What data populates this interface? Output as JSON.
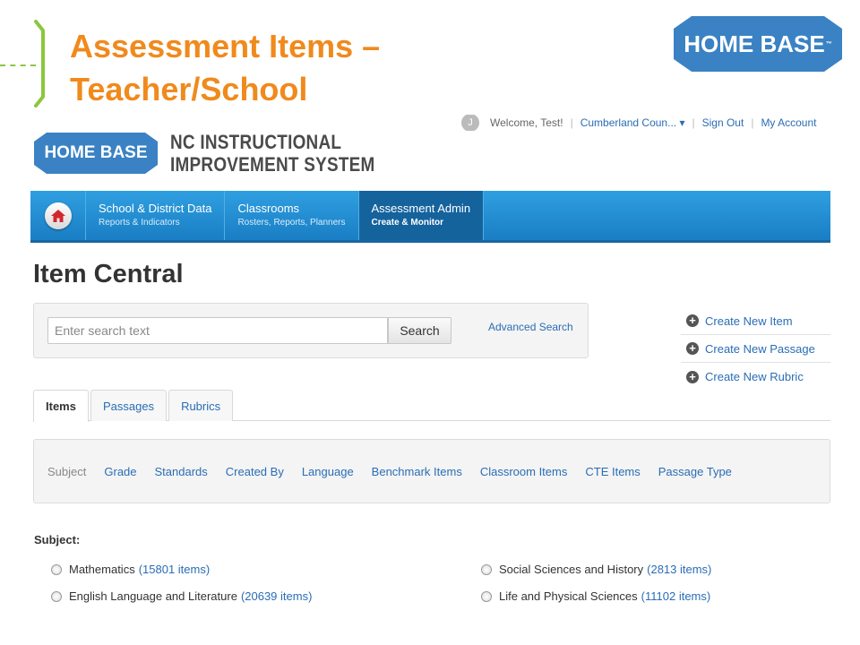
{
  "slide": {
    "title_line1": "Assessment Items –",
    "title_line2": "Teacher/School",
    "accent_color": "#f08a1c",
    "bracket_color": "#8cc63f",
    "logo_text": "HOME BASE",
    "logo_color": "#3a82c4"
  },
  "app": {
    "topbar": {
      "avatar_initial": "J",
      "welcome": "Welcome, Test!",
      "district": "Cumberland Coun...",
      "district_caret": "▾",
      "sign_out": "Sign Out",
      "my_account": "My Account"
    },
    "logo_text": "HOME BASE",
    "system_name_line1": "NC INSTRUCTIONAL",
    "system_name_line2": "IMPROVEMENT SYSTEM",
    "nav": {
      "home_icon": "home-icon",
      "items": [
        {
          "title": "School & District Data",
          "subtitle": "Reports & Indicators"
        },
        {
          "title": "Classrooms",
          "subtitle": "Rosters, Reports, Planners"
        },
        {
          "title": "Assessment Admin",
          "subtitle": "Create & Monitor"
        }
      ],
      "active_index": 2
    },
    "page_title": "Item Central",
    "search": {
      "placeholder": "Enter search text",
      "button_label": "Search",
      "advanced_label": "Advanced Search"
    },
    "create_actions": [
      {
        "label": "Create New Item",
        "icon": "plus-circle-icon"
      },
      {
        "label": "Create New Passage",
        "icon": "plus-circle-icon"
      },
      {
        "label": "Create New Rubric",
        "icon": "plus-circle-icon"
      }
    ],
    "tabs": [
      {
        "label": "Items",
        "active": true
      },
      {
        "label": "Passages",
        "active": false
      },
      {
        "label": "Rubrics",
        "active": false
      }
    ],
    "filters": [
      "Subject",
      "Grade",
      "Standards",
      "Created By",
      "Language",
      "Benchmark Items",
      "Classroom Items",
      "CTE Items",
      "Passage Type"
    ],
    "subject_label": "Subject:",
    "subjects": [
      {
        "name": "Mathematics",
        "count": "(15801 items)"
      },
      {
        "name": "English Language and Literature",
        "count": "(20639 items)"
      },
      {
        "name": "Social Sciences and History",
        "count": "(2813 items)"
      },
      {
        "name": "Life and Physical Sciences",
        "count": "(11102 items)"
      }
    ]
  }
}
